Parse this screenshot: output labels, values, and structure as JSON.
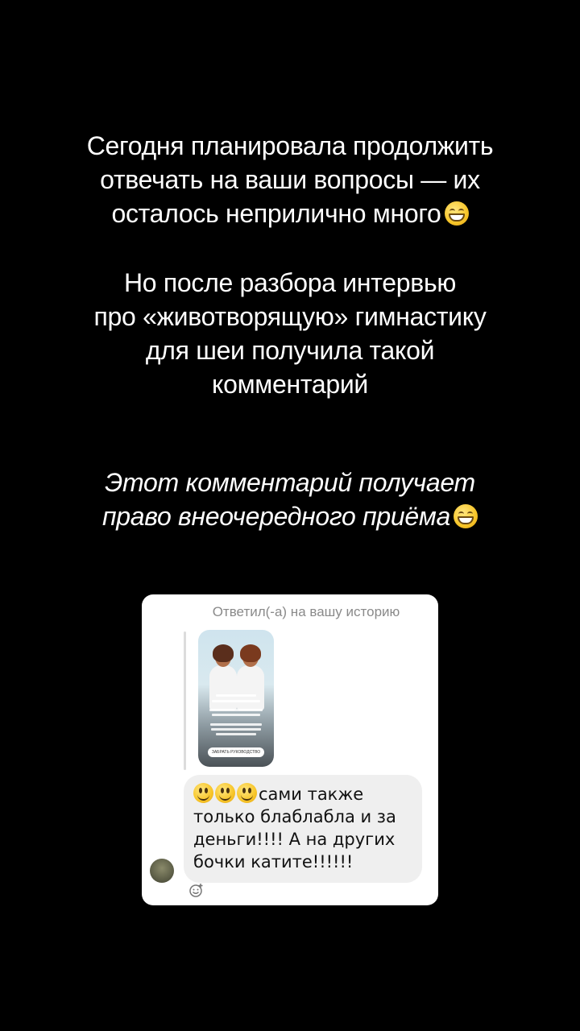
{
  "story": {
    "paragraph1": {
      "lines": [
        "Сегодня планировала продолжить",
        "отвечать на ваши вопросы — их",
        "осталось неприлично много"
      ],
      "trailing_emoji": "grinning-face-with-smiling-eyes"
    },
    "paragraph2": {
      "lines": [
        "Но после разбора интервью",
        "про «животворящую» гимнастику",
        "для шеи получила такой",
        "комментарий"
      ]
    },
    "paragraph3": {
      "lines": [
        "Этот комментарий получает",
        "право внеочередного приёма"
      ],
      "trailing_emoji": "grinning-face-with-smiling-eyes",
      "style": "italic"
    }
  },
  "dm": {
    "reply_caption": "Ответил(-а) на вашу историю",
    "story_thumbnail": {
      "cta_label": "ЗАБРАТЬ РУКОВОДСТВО"
    },
    "message": {
      "leading_emojis": [
        "slightly-smiling-face",
        "slightly-smiling-face",
        "slightly-smiling-face"
      ],
      "lines": [
        "сами также",
        "только блаблабла и за",
        "деньги!!!! А на других",
        "бочки катите!!!!!!"
      ]
    },
    "reaction_icon": "add-reaction-icon"
  },
  "colors": {
    "background": "#000000",
    "story_text": "#ffffff",
    "card_background": "#ffffff",
    "bubble_background": "#efefef",
    "caption_gray": "#8a8a8a"
  }
}
